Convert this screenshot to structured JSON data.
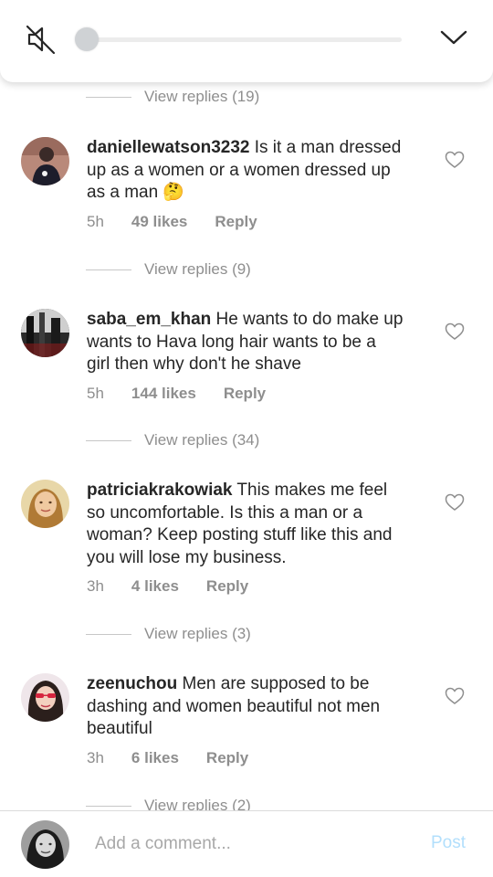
{
  "media_bar": {
    "mute_icon": "speaker-muted-icon",
    "collapse_icon": "chevron-down-icon",
    "playback_progress": 0.0
  },
  "top_replies_label": "View replies (19)",
  "comments": [
    {
      "username": "daniellewatson3232",
      "text": "Is it a man dressed\nup as a women or a women dressed up\nas a man 🤔",
      "time": "5h",
      "likes": "49 likes",
      "reply": "Reply",
      "replies_label": "View replies (9)"
    },
    {
      "username": "saba_em_khan",
      "text": "He wants to do make up\nwants to Hava long hair wants to be a\ngirl then why don't he shave",
      "time": "5h",
      "likes": "144 likes",
      "reply": "Reply",
      "replies_label": "View replies (34)"
    },
    {
      "username": "patriciakrakowiak",
      "text": "This makes me feel\nso uncomfortable.  Is this a man or a\nwoman? Keep posting stuff like this and\nyou will lose my business.",
      "time": "3h",
      "likes": "4 likes",
      "reply": "Reply",
      "replies_label": "View replies (3)"
    },
    {
      "username": "zeenuchou",
      "text": "Men are supposed to be\ndashing and women beautiful not men\nbeautiful",
      "time": "3h",
      "likes": "6 likes",
      "reply": "Reply",
      "replies_label": "View replies (2)"
    }
  ],
  "composer": {
    "placeholder": "Add a comment...",
    "post_label": "Post"
  },
  "colors": {
    "text": "#262626",
    "muted": "#8e8e8e",
    "post_disabled": "#b2dffc"
  }
}
